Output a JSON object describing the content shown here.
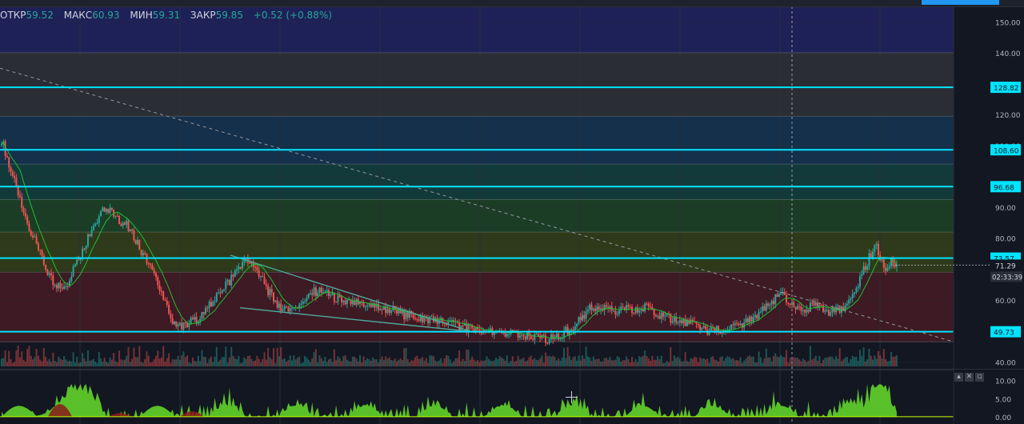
{
  "ohlc": {
    "open_label": "ОТКР",
    "open_value": "59.52",
    "high_label": "МАКС",
    "high_value": "60.93",
    "low_label": "МИН",
    "low_value": "59.31",
    "close_label": "ЗАКР",
    "close_value": "59.85",
    "change": "+0.52 (+0.88%)"
  },
  "colors": {
    "background": "#131722",
    "grid": "#2a2e39",
    "up": "#26a69a",
    "down": "#ef5350",
    "level_line": "#00e5ff",
    "ma_line": "#1fbf2f",
    "osc_fill": "#62d32a",
    "osc_neg": "#8b1a1a"
  },
  "oscillator_controls": [
    "▴",
    "✕",
    "▫"
  ],
  "chart_data": {
    "type": "candlestick",
    "y_scale": "linear",
    "ylim": [
      38,
      155
    ],
    "y_ticks": [
      "150.00",
      "140.00",
      "120.00",
      "110.00",
      "90.00",
      "80.00",
      "60.00",
      "40.00"
    ],
    "price_levels": [
      "128.82",
      "108.60",
      "96.68",
      "73.57",
      "49.73"
    ],
    "current_price_label": "71.29",
    "countdown": "02:33:39",
    "fib_zones": [
      {
        "from": 140,
        "to": 155,
        "color": "#1e2157"
      },
      {
        "from": 119.5,
        "to": 140,
        "color": "#2a2d33"
      },
      {
        "from": 104,
        "to": 119.5,
        "color": "#14304a"
      },
      {
        "from": 92.5,
        "to": 104,
        "color": "#123a3a"
      },
      {
        "from": 82,
        "to": 92.5,
        "color": "#1b3d26"
      },
      {
        "from": 69,
        "to": 82,
        "color": "#2e3a1a"
      },
      {
        "from": 46.5,
        "to": 69,
        "color": "#3d1a24"
      }
    ],
    "fib_lines": [
      140,
      119.5,
      104,
      92.5,
      82,
      69,
      46.5
    ],
    "price_path": [
      112,
      104,
      96,
      88,
      82,
      76,
      70,
      66,
      64,
      66,
      72,
      76,
      82,
      86,
      90,
      88,
      86,
      84,
      80,
      76,
      72,
      66,
      60,
      54,
      52,
      52,
      53,
      55,
      58,
      60,
      64,
      66,
      70,
      73,
      72,
      68,
      64,
      60,
      58,
      57,
      58,
      60,
      62,
      63,
      62,
      61,
      60,
      59,
      59,
      58,
      58,
      58,
      57,
      57,
      56,
      55,
      55,
      54,
      54,
      53,
      53,
      52,
      52,
      51,
      51,
      50,
      50,
      49,
      49,
      49,
      49,
      48,
      48,
      48,
      47,
      48,
      49,
      50,
      52,
      55,
      57,
      58,
      58,
      57,
      56,
      57,
      56,
      57,
      58,
      56,
      54,
      54,
      53,
      53,
      52,
      51,
      50,
      50,
      50,
      51,
      51,
      52,
      54,
      56,
      58,
      60,
      62,
      59,
      58,
      57,
      58,
      59,
      57,
      56,
      57,
      59,
      63,
      68,
      74,
      78,
      70,
      72
    ],
    "oscillator": {
      "ylim": [
        -2,
        13
      ],
      "y_ticks": [
        "10.00",
        "5.00",
        "0.00"
      ]
    }
  }
}
